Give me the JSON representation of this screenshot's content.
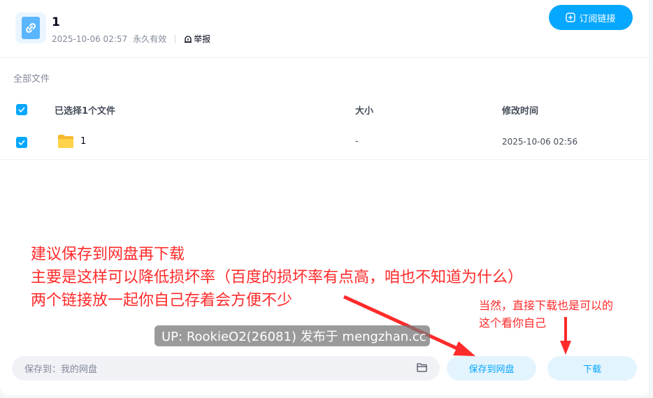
{
  "share": {
    "title": "1",
    "date": "2025-10-06 02:57",
    "validity": "永久有效",
    "report_label": "举报",
    "subscribe_label": "订阅链接"
  },
  "breadcrumb": "全部文件",
  "table": {
    "headers": [
      "已选择1个文件",
      "大小",
      "修改时间"
    ],
    "rows": [
      {
        "name": "1",
        "size": "-",
        "modified": "2025-10-06 02:56",
        "checked": true
      }
    ]
  },
  "annotations": {
    "line1": "建议保存到网盘再下载",
    "line2": "主要是这样可以降低损坏率（百度的损坏率有点高，咱也不知道为什么）",
    "line3": "两个链接放一起你自己存着会方便不少",
    "side1": "当然，直接下载也是可以的",
    "side2": "这个看你自己"
  },
  "watermark": "UP: RookieO2(26081) 发布于 mengzhan.cc",
  "footer": {
    "save_to_label": "保存到：我的网盘",
    "save_button": "保存到网盘",
    "download_button": "下载"
  },
  "colors": {
    "accent": "#06a7ff",
    "annotation": "#ff2a2a"
  },
  "icons": {
    "share": "link-doc-icon",
    "report": "report-icon",
    "subscribe": "plus-circle-icon",
    "folder": "folder-icon"
  }
}
